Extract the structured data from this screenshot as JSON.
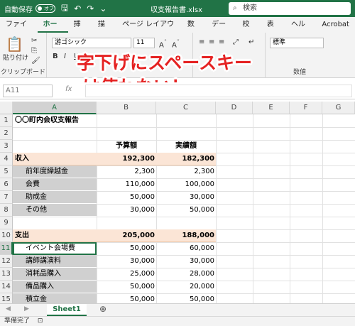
{
  "titlebar": {
    "autosave_label": "自動保存",
    "toggle_state": "オフ",
    "filename": "収支報告書.xlsx",
    "search_placeholder": "検索"
  },
  "tabs": [
    "ファイル",
    "ホーム",
    "挿入",
    "描画",
    "ページ レイアウト",
    "数式",
    "データ",
    "校閲",
    "表示",
    "ヘルプ",
    "Acrobat"
  ],
  "active_tab": "ホーム",
  "ribbon": {
    "paste_label": "貼り付け",
    "clipboard_label": "クリップボード",
    "font_name": "游ゴシック",
    "font_size": "11",
    "number_format": "標準",
    "number_label": "数値"
  },
  "formula_bar": {
    "name_box": "A11",
    "fx": "fx"
  },
  "overlay": {
    "line1": "字下げにスペースキー",
    "line2": "は使わない！"
  },
  "columns": [
    "A",
    "B",
    "C",
    "D",
    "E",
    "F",
    "G"
  ],
  "rows": [
    "1",
    "2",
    "3",
    "4",
    "5",
    "6",
    "7",
    "8",
    "9",
    "10",
    "11",
    "12",
    "13",
    "14",
    "15",
    "16"
  ],
  "sheet": {
    "title": "〇〇町内会収支報告",
    "header_budget": "予算額",
    "header_actual": "実績額",
    "income": {
      "label": "収入",
      "budget": "192,300",
      "actual": "182,300"
    },
    "income_items": [
      {
        "label": "前年度繰越金",
        "budget": "2,300",
        "actual": "2,300"
      },
      {
        "label": "会費",
        "budget": "110,000",
        "actual": "100,000"
      },
      {
        "label": "助成金",
        "budget": "50,000",
        "actual": "30,000"
      },
      {
        "label": "その他",
        "budget": "30,000",
        "actual": "50,000"
      }
    ],
    "expense": {
      "label": "支出",
      "budget": "205,000",
      "actual": "188,000"
    },
    "expense_items": [
      {
        "label": "イベント会場費",
        "budget": "50,000",
        "actual": "60,000"
      },
      {
        "label": "講師講演料",
        "budget": "30,000",
        "actual": "30,000"
      },
      {
        "label": "消耗品購入",
        "budget": "25,000",
        "actual": "28,000"
      },
      {
        "label": "備品購入",
        "budget": "50,000",
        "actual": "20,000"
      },
      {
        "label": "積立金",
        "budget": "50,000",
        "actual": "50,000"
      }
    ]
  },
  "sheet_tab": "Sheet1",
  "status": "準備完了",
  "colors": {
    "excel_green": "#217346",
    "section_fill": "#fbe5d6",
    "item_fill": "#d0d0d0",
    "overlay_text": "#e52222"
  }
}
